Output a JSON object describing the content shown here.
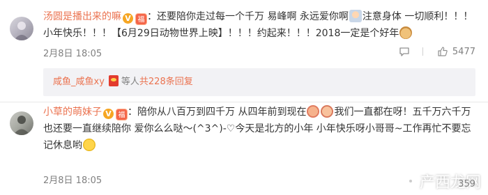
{
  "comments": [
    {
      "username": "汤圆是播出来的嘛",
      "text_a": "：还要陪你走过每一个千万 易峰啊 永远爱你啊",
      "text_b": "注意身体 一切顺利！！！小年快乐！！！【6月29日动物世界上映】！！！约起来！！！2018一定是个好年",
      "date": "2月8日 18:05",
      "like_count": "5477",
      "replies": {
        "first_replier": "咸鱼_咸鱼xy",
        "suffix": "等人",
        "total": "共228条回复"
      }
    },
    {
      "username": "小草的萌妹子",
      "text_a": "：陪你从八百万到四千万 从四年前到现在",
      "text_b": "我们一直都在呀！五千万六千万也还要一直继续陪你 爱你么么哒～(^3^)-♡今天是北方的小年 小年快乐呀小哥哥~工作再忙不要忘记休息哟",
      "date": "2月8日 18:05",
      "like_count": "359"
    }
  ],
  "watermark": {
    "text": "产西龙网"
  },
  "icons": {
    "verified_badge": "V",
    "red_badge": "福",
    "reply_icon": "comment-bubble-icon",
    "like_icon": "thumbs-up-icon"
  },
  "colors": {
    "username": "#eb7350",
    "meta": "#808080",
    "reply_bg": "#f2f2f5"
  }
}
